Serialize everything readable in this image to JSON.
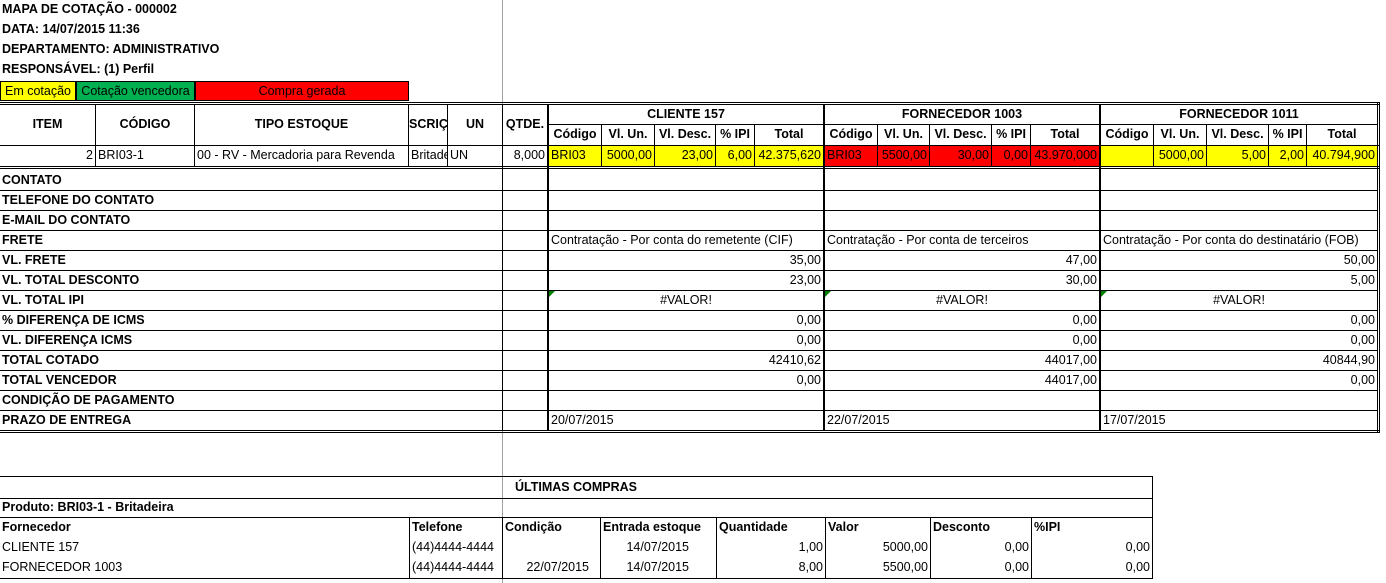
{
  "header": {
    "title": "MAPA DE COTAÇÃO - 000002",
    "date": "DATA: 14/07/2015 11:36",
    "department": "DEPARTAMENTO: ADMINISTRATIVO",
    "responsible": "RESPONSÁVEL: (1) Perfil"
  },
  "legend": {
    "em_cotacao": "Em cotação",
    "cotacao_vencedora": "Cotação vencedora",
    "compra_gerada": "Compra gerada",
    "colors": {
      "yellow": "#ffff00",
      "green": "#00b050",
      "red": "#ff0000"
    }
  },
  "table": {
    "headers": {
      "item": "ITEM",
      "codigo": "CÓDIGO",
      "tipo_estoque": "TIPO ESTOQUE",
      "descricao": "SCRIÇ",
      "un": "UN",
      "qtde": "QTDE."
    },
    "supplier_subheaders": [
      "Código",
      "Vl. Un.",
      "Vl. Desc.",
      "% IPI",
      "Total"
    ],
    "suppliers": [
      {
        "name": "CLIENTE  157",
        "codigo": "BRI03",
        "vl_un": "5000,00",
        "vl_desc": "23,00",
        "ipi": "6,00",
        "total": "42.375,620"
      },
      {
        "name": "FORNECEDOR  1003",
        "codigo": "BRI03",
        "vl_un": "5500,00",
        "vl_desc": "30,00",
        "ipi": "0,00",
        "total": "43.970,000"
      },
      {
        "name": "FORNECEDOR  1011",
        "codigo": "",
        "vl_un": "5000,00",
        "vl_desc": "5,00",
        "ipi": "2,00",
        "total": "40.794,900"
      }
    ],
    "row": {
      "item": "2",
      "codigo": "BRI03-1",
      "tipo_estoque": "00 - RV - Mercadoria para Revenda",
      "descricao": "Britade",
      "un": "UN",
      "qtde": "8,000"
    }
  },
  "details": {
    "labels": [
      "CONTATO",
      "TELEFONE DO CONTATO",
      "E-MAIL DO CONTATO",
      "FRETE",
      "VL. FRETE",
      "VL. TOTAL DESCONTO",
      "VL. TOTAL IPI",
      "% DIFERENÇA DE ICMS",
      "VL. DIFERENÇA ICMS",
      "TOTAL COTADO",
      "TOTAL VENCEDOR",
      "CONDIÇÃO DE PAGAMENTO",
      "PRAZO DE ENTREGA"
    ],
    "frete": [
      "Contratação - Por conta do remetente (CIF)",
      "Contratação - Por conta de terceiros",
      "Contratação - Por conta do destinatário (FOB)"
    ],
    "vl_frete": [
      "35,00",
      "47,00",
      "50,00"
    ],
    "vl_total_desconto": [
      "23,00",
      "30,00",
      "5,00"
    ],
    "vl_total_ipi": [
      "#VALOR!",
      "#VALOR!",
      "#VALOR!"
    ],
    "pct_dif_icms": [
      "0,00",
      "0,00",
      "0,00"
    ],
    "vl_dif_icms": [
      "0,00",
      "0,00",
      "0,00"
    ],
    "total_cotado": [
      "42410,62",
      "44017,00",
      "40844,90"
    ],
    "total_vencedor": [
      "0,00",
      "44017,00",
      "0,00"
    ],
    "prazo_entrega": [
      "20/07/2015",
      "22/07/2015",
      "17/07/2015"
    ]
  },
  "ultimas_compras": {
    "title": "ÚLTIMAS COMPRAS",
    "produto": "Produto: BRI03-1 - Britadeira",
    "columns": [
      "Fornecedor",
      "Telefone",
      "Condição",
      "Entrada estoque",
      "Quantidade",
      "Valor",
      "Desconto",
      "%IPI"
    ],
    "rows": [
      {
        "fornecedor": "CLIENTE  157",
        "telefone": "(44)4444-4444",
        "condicao": "",
        "entrada": "14/07/2015",
        "quantidade": "1,00",
        "valor": "5000,00",
        "desconto": "0,00",
        "ipi": "0,00"
      },
      {
        "fornecedor": "FORNECEDOR  1003",
        "telefone": "(44)4444-4444",
        "condicao": "22/07/2015",
        "entrada": "14/07/2015",
        "quantidade": "8,00",
        "valor": "5500,00",
        "desconto": "0,00",
        "ipi": "0,00"
      }
    ]
  }
}
